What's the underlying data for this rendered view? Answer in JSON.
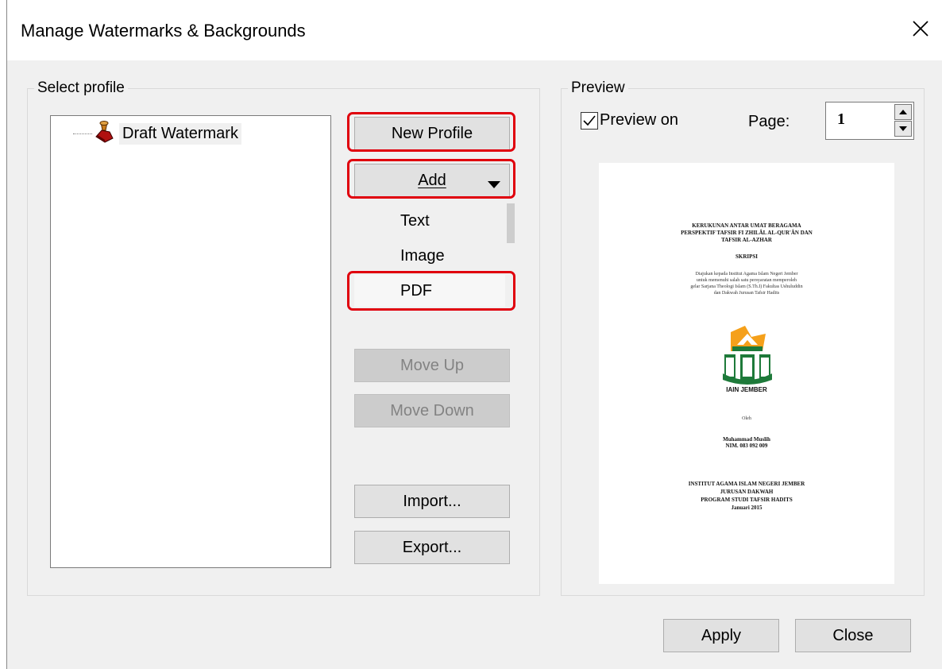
{
  "window": {
    "title": "Manage Watermarks & Backgrounds"
  },
  "select_profile": {
    "group_label": "Select profile",
    "tree_items": [
      {
        "label": "Draft Watermark",
        "icon": "stamp-icon"
      }
    ]
  },
  "buttons": {
    "new_profile": "New Profile",
    "add": "Add",
    "move_up": "Move Up",
    "move_down": "Move Down",
    "import": "Import...",
    "export": "Export...",
    "apply": "Apply",
    "close": "Close"
  },
  "add_menu": {
    "items": [
      "Text",
      "Image",
      "PDF"
    ]
  },
  "preview": {
    "group_label": "Preview",
    "preview_on_label": "Preview on",
    "preview_on_checked": true,
    "page_label": "Page:",
    "page_value": "1"
  },
  "document": {
    "title_lines": [
      "KERUKUNAN ANTAR UMAT BERAGAMA",
      "PERSPEKTIF TAFSIR FI ZHILÂL AL-QUR'ÂN DAN",
      "TAFSIR AL-AZHAR"
    ],
    "doc_type": "SKRIPSI",
    "description_lines": [
      "Diajukan kepada Institut Agama Islam Negeri Jember",
      "untuk memenuhi salah satu persyaratan memperoleh",
      "gelar Sarjana Theologi Islam (S.Th.I) Fakultas Ushuluddin",
      "dan Dakwah Jurusan Tafsir Hadits"
    ],
    "logo_text": "IAIN JEMBER",
    "by_label": "Oleh",
    "author_name": "Muhammad Muslih",
    "author_nim": "NIM. 083 092 009",
    "institution_lines": [
      "INSTITUT AGAMA ISLAM NEGERI JEMBER",
      "JURUSAN DAKWAH",
      "PROGRAM STUDI TAFSIR HADITS",
      "Januari 2015"
    ]
  },
  "colors": {
    "highlight": "#e0000d",
    "logo_orange": "#f5a01a",
    "logo_green": "#1e7a3a"
  }
}
